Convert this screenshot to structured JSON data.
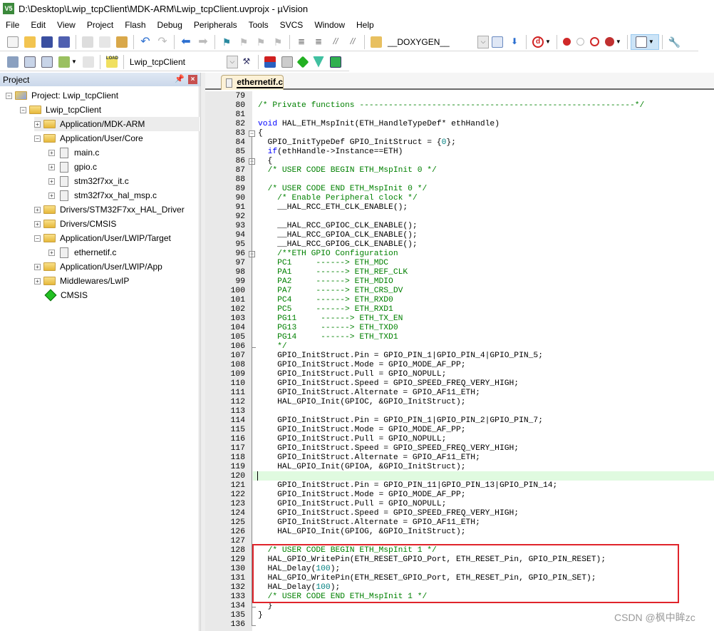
{
  "window": {
    "title": "D:\\Desktop\\Lwip_tcpClient\\MDK-ARM\\Lwip_tcpClient.uvprojx - µVision",
    "logo": "V5"
  },
  "menu": [
    "File",
    "Edit",
    "View",
    "Project",
    "Flash",
    "Debug",
    "Peripherals",
    "Tools",
    "SVCS",
    "Window",
    "Help"
  ],
  "toolbar": {
    "find_combo": "__DOXYGEN__",
    "target_combo": "Lwip_tcpClient",
    "load_label": "LOAD"
  },
  "colors": {
    "accent": "#e0242b",
    "comment": "#008000",
    "keyword": "#0000ff",
    "number": "#008080"
  },
  "project_panel": {
    "title": "Project",
    "tree": [
      {
        "label": "Project: Lwip_tcpClient",
        "level": 0,
        "type": "project",
        "expand": "-"
      },
      {
        "label": "Lwip_tcpClient",
        "level": 1,
        "type": "folder",
        "expand": "-"
      },
      {
        "label": "Application/MDK-ARM",
        "level": 2,
        "type": "folder",
        "expand": "+",
        "selected": true
      },
      {
        "label": "Application/User/Core",
        "level": 2,
        "type": "folder",
        "expand": "-"
      },
      {
        "label": "main.c",
        "level": 3,
        "type": "file",
        "expand": "+"
      },
      {
        "label": "gpio.c",
        "level": 3,
        "type": "file",
        "expand": "+"
      },
      {
        "label": "stm32f7xx_it.c",
        "level": 3,
        "type": "file",
        "expand": "+"
      },
      {
        "label": "stm32f7xx_hal_msp.c",
        "level": 3,
        "type": "file",
        "expand": "+"
      },
      {
        "label": "Drivers/STM32F7xx_HAL_Driver",
        "level": 2,
        "type": "folder",
        "expand": "+"
      },
      {
        "label": "Drivers/CMSIS",
        "level": 2,
        "type": "folder",
        "expand": "+"
      },
      {
        "label": "Application/User/LWIP/Target",
        "level": 2,
        "type": "folder",
        "expand": "-"
      },
      {
        "label": "ethernetif.c",
        "level": 3,
        "type": "file",
        "expand": "+"
      },
      {
        "label": "Application/User/LWIP/App",
        "level": 2,
        "type": "folder",
        "expand": "+"
      },
      {
        "label": "Middlewares/LwIP",
        "level": 2,
        "type": "folder",
        "expand": "+"
      },
      {
        "label": "CMSIS",
        "level": 2,
        "type": "component",
        "expand": ""
      }
    ]
  },
  "editor": {
    "tab": "ethernetif.c",
    "lines": [
      {
        "n": "79",
        "s": []
      },
      {
        "n": "80",
        "s": [
          [
            "c",
            "/* Private functions ---------------------------------------------------------*/"
          ]
        ]
      },
      {
        "n": "81",
        "s": []
      },
      {
        "n": "82",
        "s": [
          [
            "k",
            "void"
          ],
          [
            "t",
            " HAL_ETH_MspInit(ETH_HandleTypeDef* ethHandle)"
          ]
        ]
      },
      {
        "n": "83",
        "s": [
          [
            "t",
            "{"
          ]
        ]
      },
      {
        "n": "84",
        "s": [
          [
            "t",
            "  GPIO_InitTypeDef GPIO_InitStruct = {"
          ],
          [
            "n",
            "0"
          ],
          [
            "t",
            "};"
          ]
        ]
      },
      {
        "n": "85",
        "s": [
          [
            "t",
            "  "
          ],
          [
            "k",
            "if"
          ],
          [
            "t",
            "(ethHandle->Instance==ETH)"
          ]
        ]
      },
      {
        "n": "86",
        "s": [
          [
            "t",
            "  {"
          ]
        ]
      },
      {
        "n": "87",
        "s": [
          [
            "t",
            "  "
          ],
          [
            "c",
            "/* USER CODE BEGIN ETH_MspInit 0 */"
          ]
        ]
      },
      {
        "n": "88",
        "s": []
      },
      {
        "n": "89",
        "s": [
          [
            "t",
            "  "
          ],
          [
            "c",
            "/* USER CODE END ETH_MspInit 0 */"
          ]
        ]
      },
      {
        "n": "90",
        "s": [
          [
            "t",
            "    "
          ],
          [
            "c",
            "/* Enable Peripheral clock */"
          ]
        ]
      },
      {
        "n": "91",
        "s": [
          [
            "t",
            "    __HAL_RCC_ETH_CLK_ENABLE();"
          ]
        ]
      },
      {
        "n": "92",
        "s": []
      },
      {
        "n": "93",
        "s": [
          [
            "t",
            "    __HAL_RCC_GPIOC_CLK_ENABLE();"
          ]
        ]
      },
      {
        "n": "94",
        "s": [
          [
            "t",
            "    __HAL_RCC_GPIOA_CLK_ENABLE();"
          ]
        ]
      },
      {
        "n": "95",
        "s": [
          [
            "t",
            "    __HAL_RCC_GPIOG_CLK_ENABLE();"
          ]
        ]
      },
      {
        "n": "96",
        "s": [
          [
            "t",
            "    "
          ],
          [
            "c",
            "/**ETH GPIO Configuration"
          ]
        ]
      },
      {
        "n": "97",
        "s": [
          [
            "c",
            "    PC1     ------> ETH_MDC"
          ]
        ]
      },
      {
        "n": "98",
        "s": [
          [
            "c",
            "    PA1     ------> ETH_REF_CLK"
          ]
        ]
      },
      {
        "n": "99",
        "s": [
          [
            "c",
            "    PA2     ------> ETH_MDIO"
          ]
        ]
      },
      {
        "n": "100",
        "s": [
          [
            "c",
            "    PA7     ------> ETH_CRS_DV"
          ]
        ]
      },
      {
        "n": "101",
        "s": [
          [
            "c",
            "    PC4     ------> ETH_RXD0"
          ]
        ]
      },
      {
        "n": "102",
        "s": [
          [
            "c",
            "    PC5     ------> ETH_RXD1"
          ]
        ]
      },
      {
        "n": "103",
        "s": [
          [
            "c",
            "    PG11     ------> ETH_TX_EN"
          ]
        ]
      },
      {
        "n": "104",
        "s": [
          [
            "c",
            "    PG13     ------> ETH_TXD0"
          ]
        ]
      },
      {
        "n": "105",
        "s": [
          [
            "c",
            "    PG14     ------> ETH_TXD1"
          ]
        ]
      },
      {
        "n": "106",
        "s": [
          [
            "c",
            "    */"
          ]
        ]
      },
      {
        "n": "107",
        "s": [
          [
            "t",
            "    GPIO_InitStruct.Pin = GPIO_PIN_1|GPIO_PIN_4|GPIO_PIN_5;"
          ]
        ]
      },
      {
        "n": "108",
        "s": [
          [
            "t",
            "    GPIO_InitStruct.Mode = GPIO_MODE_AF_PP;"
          ]
        ]
      },
      {
        "n": "109",
        "s": [
          [
            "t",
            "    GPIO_InitStruct.Pull = GPIO_NOPULL;"
          ]
        ]
      },
      {
        "n": "110",
        "s": [
          [
            "t",
            "    GPIO_InitStruct.Speed = GPIO_SPEED_FREQ_VERY_HIGH;"
          ]
        ]
      },
      {
        "n": "111",
        "s": [
          [
            "t",
            "    GPIO_InitStruct.Alternate = GPIO_AF11_ETH;"
          ]
        ]
      },
      {
        "n": "112",
        "s": [
          [
            "t",
            "    HAL_GPIO_Init(GPIOC, &GPIO_InitStruct);"
          ]
        ]
      },
      {
        "n": "113",
        "s": []
      },
      {
        "n": "114",
        "s": [
          [
            "t",
            "    GPIO_InitStruct.Pin = GPIO_PIN_1|GPIO_PIN_2|GPIO_PIN_7;"
          ]
        ]
      },
      {
        "n": "115",
        "s": [
          [
            "t",
            "    GPIO_InitStruct.Mode = GPIO_MODE_AF_PP;"
          ]
        ]
      },
      {
        "n": "116",
        "s": [
          [
            "t",
            "    GPIO_InitStruct.Pull = GPIO_NOPULL;"
          ]
        ]
      },
      {
        "n": "117",
        "s": [
          [
            "t",
            "    GPIO_InitStruct.Speed = GPIO_SPEED_FREQ_VERY_HIGH;"
          ]
        ]
      },
      {
        "n": "118",
        "s": [
          [
            "t",
            "    GPIO_InitStruct.Alternate = GPIO_AF11_ETH;"
          ]
        ]
      },
      {
        "n": "119",
        "s": [
          [
            "t",
            "    HAL_GPIO_Init(GPIOA, &GPIO_InitStruct);"
          ]
        ]
      },
      {
        "n": "120",
        "s": []
      },
      {
        "n": "121",
        "s": [
          [
            "t",
            "    GPIO_InitStruct.Pin = GPIO_PIN_11|GPIO_PIN_13|GPIO_PIN_14;"
          ]
        ]
      },
      {
        "n": "122",
        "s": [
          [
            "t",
            "    GPIO_InitStruct.Mode = GPIO_MODE_AF_PP;"
          ]
        ]
      },
      {
        "n": "123",
        "s": [
          [
            "t",
            "    GPIO_InitStruct.Pull = GPIO_NOPULL;"
          ]
        ]
      },
      {
        "n": "124",
        "s": [
          [
            "t",
            "    GPIO_InitStruct.Speed = GPIO_SPEED_FREQ_VERY_HIGH;"
          ]
        ]
      },
      {
        "n": "125",
        "s": [
          [
            "t",
            "    GPIO_InitStruct.Alternate = GPIO_AF11_ETH;"
          ]
        ]
      },
      {
        "n": "126",
        "s": [
          [
            "t",
            "    HAL_GPIO_Init(GPIOG, &GPIO_InitStruct);"
          ]
        ]
      },
      {
        "n": "127",
        "s": []
      },
      {
        "n": "128",
        "s": [
          [
            "t",
            "  "
          ],
          [
            "c",
            "/* USER CODE BEGIN ETH_MspInit 1 */"
          ]
        ]
      },
      {
        "n": "129",
        "s": [
          [
            "t",
            "  HAL_GPIO_WritePin(ETH_RESET_GPIO_Port, ETH_RESET_Pin, GPIO_PIN_RESET);"
          ]
        ]
      },
      {
        "n": "130",
        "s": [
          [
            "t",
            "  HAL_Delay("
          ],
          [
            "n",
            "100"
          ],
          [
            "t",
            ");"
          ]
        ]
      },
      {
        "n": "131",
        "s": [
          [
            "t",
            "  HAL_GPIO_WritePin(ETH_RESET_GPIO_Port, ETH_RESET_Pin, GPIO_PIN_SET);"
          ]
        ]
      },
      {
        "n": "132",
        "s": [
          [
            "t",
            "  HAL_Delay("
          ],
          [
            "n",
            "100"
          ],
          [
            "t",
            ");"
          ]
        ]
      },
      {
        "n": "133",
        "s": [
          [
            "t",
            "  "
          ],
          [
            "c",
            "/* USER CODE END ETH_MspInit 1 */"
          ]
        ]
      },
      {
        "n": "134",
        "s": [
          [
            "t",
            "  }"
          ]
        ]
      },
      {
        "n": "135",
        "s": [
          [
            "t",
            "}"
          ]
        ]
      },
      {
        "n": "136",
        "s": []
      }
    ]
  },
  "watermark": "CSDN @枫中眸zc"
}
